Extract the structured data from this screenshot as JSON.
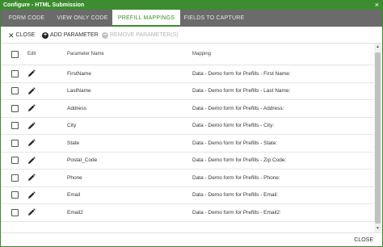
{
  "window": {
    "title": "Configure - HTML Submission",
    "close_glyph": "×"
  },
  "tabs": [
    {
      "label": "FORM CODE",
      "active": false
    },
    {
      "label": "VIEW ONLY CODE",
      "active": false
    },
    {
      "label": "PREFILL MAPPINGS",
      "active": true
    },
    {
      "label": "FIELDS TO CAPTURE",
      "active": false
    }
  ],
  "toolbar": {
    "close_label": "CLOSE",
    "add_label": "ADD PARAMETER",
    "remove_label": "REMOVE PARAMETER(S)",
    "remove_disabled": true
  },
  "table": {
    "headers": {
      "edit": "Edit",
      "parameter_name": "Parameter Name",
      "mapping": "Mapping"
    },
    "rows": [
      {
        "parameter": "FirstName",
        "mapping": "Data - Demo form for Prefills - First Name:"
      },
      {
        "parameter": "LastName",
        "mapping": "Data - Demo form for Prefills - Last Name:"
      },
      {
        "parameter": "Address",
        "mapping": "Data - Demo form for Prefills - Address:"
      },
      {
        "parameter": "City",
        "mapping": "Data - Demo form for Prefills - City:"
      },
      {
        "parameter": "State",
        "mapping": "Data - Demo form for Prefills - State:"
      },
      {
        "parameter": "Postal_Code",
        "mapping": "Data - Demo form for Prefills - Zip Code:"
      },
      {
        "parameter": "Phone",
        "mapping": "Data - Demo form for Prefills - Phone:"
      },
      {
        "parameter": "Email",
        "mapping": "Data - Demo form for Prefills - Email:"
      },
      {
        "parameter": "Email2",
        "mapping": "Data - Demo form for Prefills - Email2:"
      }
    ]
  },
  "footer": {
    "close_label": "CLOSE"
  },
  "colors": {
    "accent": "#3c8d2f",
    "tab_bar": "#6b6b6b"
  }
}
